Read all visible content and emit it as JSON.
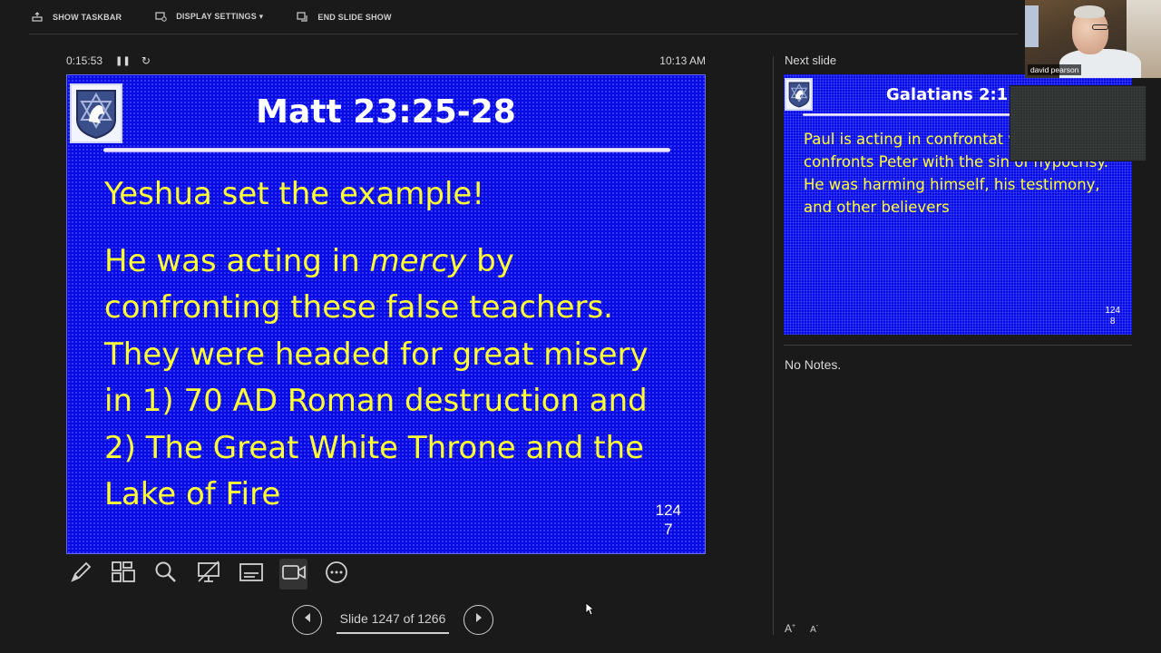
{
  "toolbar": {
    "show_taskbar": "SHOW TASKBAR",
    "display_settings": "DISPLAY SETTINGS ▾",
    "end_slide_show": "END SLIDE SHOW"
  },
  "timer": {
    "elapsed": "0:15:53",
    "clock": "10:13 AM"
  },
  "current_slide": {
    "title": "Matt 23:25-28",
    "lead": "Yeshua set the example!",
    "body_before": "He was acting in ",
    "body_em": "mercy",
    "body_after": " by confronting these false teachers. They were headed for great misery in 1) 70 AD Roman destruction and 2) The Great White Throne and the Lake of Fire",
    "number_top": "124",
    "number_bottom": "7"
  },
  "navigation": {
    "label": "Slide 1247 of 1266"
  },
  "next_slide": {
    "heading": "Next slide",
    "title": "Galatians 2:11",
    "body": "Paul is acting in confrontat when he confronts Peter with the sin of hypocrisy. He was harming himself, his testimony, and other believers",
    "number_top": "124",
    "number_bottom": "8"
  },
  "notes": {
    "text": "No Notes."
  },
  "font_controls": {
    "increase": "A",
    "decrease": "A"
  },
  "video": {
    "participant_name": "david pearson"
  },
  "colors": {
    "slide_background": "#0a0ae6",
    "slide_text": "#ffff33",
    "app_background": "#1a1a1a"
  },
  "icons": [
    "taskbar-icon",
    "display-settings-icon",
    "end-show-icon",
    "pause-icon",
    "reset-icon",
    "pen-icon",
    "see-all-slides-icon",
    "zoom-icon",
    "black-screen-icon",
    "subtitles-icon",
    "camera-icon",
    "more-options-icon",
    "previous-icon",
    "next-icon"
  ]
}
